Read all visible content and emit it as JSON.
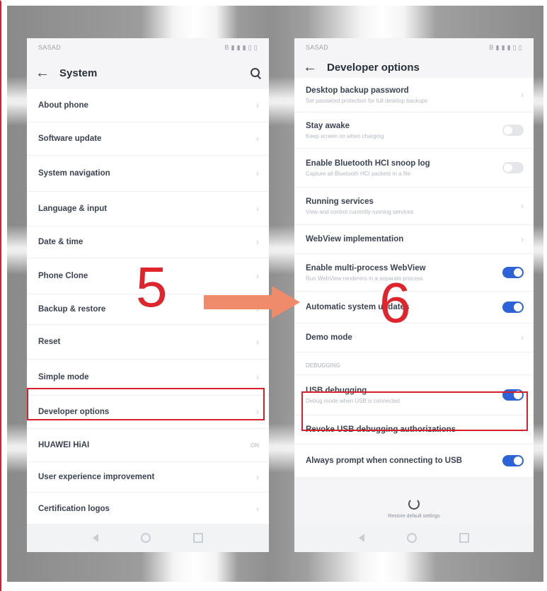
{
  "left_screen": {
    "status_left": "SASAD",
    "status_right": "B ▮ ▮ ▮ ▯ ▯",
    "title": "System",
    "items": [
      {
        "label": "About phone",
        "height": 46
      },
      {
        "label": "Software update",
        "height": 46
      },
      {
        "label": "System navigation",
        "height": 50
      },
      {
        "label": "Language & input",
        "height": 48
      },
      {
        "label": "Date & time",
        "height": 44
      },
      {
        "label": "Phone Clone",
        "height": 50
      },
      {
        "label": "Backup & restore",
        "height": 42
      },
      {
        "label": "Reset",
        "height": 48
      },
      {
        "label": "Simple mode",
        "height": 50
      },
      {
        "label": "Developer options",
        "height": 46
      },
      {
        "label": "HUAWEI HiAI",
        "height": 46,
        "badge": "ON"
      },
      {
        "label": "User experience improvement",
        "height": 42
      },
      {
        "label": "Certification logos",
        "height": 46
      }
    ]
  },
  "right_screen": {
    "status_left": "SASAD",
    "status_right": "B ▮ ▮ ▮ ▯ ▯",
    "title": "Developer options",
    "items": [
      {
        "label": "Desktop backup password",
        "sub": "Set password protection for full desktop backups",
        "control": "chevron"
      },
      {
        "label": "Stay awake",
        "sub": "Keep screen on when charging",
        "control": "off"
      },
      {
        "label": "Enable Bluetooth HCI snoop log",
        "sub": "Capture all Bluetooth HCI packets in a file",
        "control": "off"
      },
      {
        "label": "Running services",
        "sub": "View and control currently running services",
        "control": "chevron"
      },
      {
        "label": "WebView implementation",
        "control": "chevron"
      },
      {
        "label": "Enable multi-process WebView",
        "sub": "Run WebView renderers in a separate process",
        "control": "on"
      },
      {
        "label": "Automatic system updates",
        "control": "on"
      },
      {
        "label": "Demo mode",
        "control": "chevron"
      }
    ],
    "section": "DEBUGGING",
    "debug_items": [
      {
        "label": "USB debugging",
        "sub": "Debug mode when USB is connected",
        "control": "on"
      },
      {
        "label": "Revoke USB debugging authorizations",
        "control": "chevron"
      },
      {
        "label": "Always prompt when connecting to USB",
        "control": "on"
      }
    ],
    "restore_label": "Restore default settings"
  },
  "annotations": {
    "step_left": "5",
    "step_right": "6"
  },
  "colors": {
    "highlight": "#d8202a",
    "arrow": "#ef8a6a",
    "toggle_on": "#2d63d6"
  }
}
